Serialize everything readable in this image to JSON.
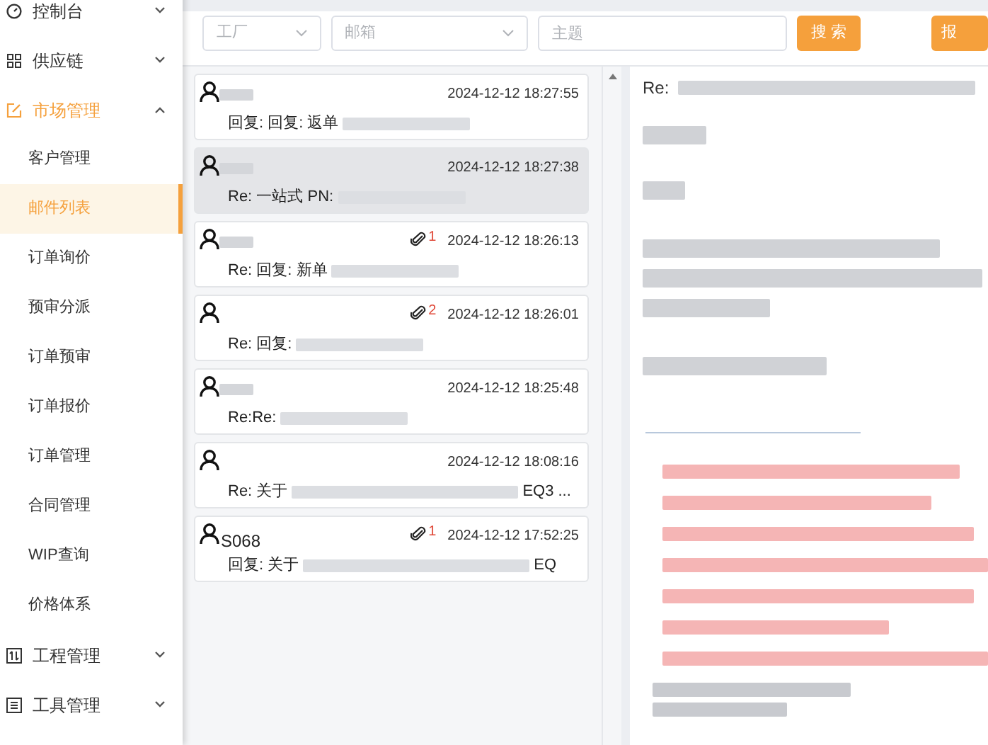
{
  "sidebar": {
    "items": [
      {
        "label": "控制台",
        "expanded": false
      },
      {
        "label": "供应链",
        "expanded": false
      },
      {
        "label": "市场管理",
        "expanded": true,
        "selected": true,
        "children": [
          {
            "label": "客户管理",
            "selected": false
          },
          {
            "label": "邮件列表",
            "selected": true
          },
          {
            "label": "订单询价",
            "selected": false
          },
          {
            "label": "预审分派",
            "selected": false
          },
          {
            "label": "订单预审",
            "selected": false
          },
          {
            "label": "订单报价",
            "selected": false
          },
          {
            "label": "订单管理",
            "selected": false
          },
          {
            "label": "合同管理",
            "selected": false
          },
          {
            "label": "WIP查询",
            "selected": false
          },
          {
            "label": "价格体系",
            "selected": false
          }
        ]
      },
      {
        "label": "工程管理",
        "expanded": false
      },
      {
        "label": "工具管理",
        "expanded": false
      }
    ]
  },
  "filters": {
    "factory": {
      "placeholder": "工厂"
    },
    "mailbox": {
      "placeholder": "邮箱"
    },
    "subject": {
      "placeholder": "主题"
    },
    "search_button": "搜 索",
    "quote_button": "报"
  },
  "emails": [
    {
      "sender_redacted": true,
      "time": "2024-12-12 18:27:55",
      "subject_start": "回复: 回复: 返单",
      "selected": false
    },
    {
      "sender_redacted": true,
      "time": "2024-12-12 18:27:38",
      "subject_start": "Re: 一站式 PN:",
      "selected": true
    },
    {
      "sender_redacted": true,
      "time": "2024-12-12 18:26:13",
      "attachments": "1",
      "subject_start": "Re: 回复: 新单",
      "selected": false
    },
    {
      "sender_redacted": false,
      "time": "2024-12-12 18:26:01",
      "attachments": "2",
      "subject_start": "Re: 回复:",
      "selected": false
    },
    {
      "sender_redacted": true,
      "time": "2024-12-12 18:25:48",
      "subject_start": "Re:Re:",
      "selected": false
    },
    {
      "sender_redacted": false,
      "time": "2024-12-12 18:08:16",
      "subject_start": "Re: 关于",
      "subject_end": "EQ3 ...",
      "selected": false
    },
    {
      "sender": "S068",
      "sender_redacted": false,
      "time": "2024-12-12 17:52:25",
      "attachments": "1",
      "subject_start": "回复: 关于",
      "subject_end": "EQ",
      "selected": false
    }
  ],
  "detail": {
    "subject_start": "Re:",
    "body": [
      {
        "kind": "plain"
      },
      {
        "kind": "plain"
      },
      {
        "kind": "plain"
      },
      {
        "kind": "plain"
      },
      {
        "kind": "plain"
      },
      {
        "kind": "plain"
      },
      {
        "kind": "rule"
      },
      {
        "kind": "highlight"
      },
      {
        "kind": "highlight"
      },
      {
        "kind": "highlight"
      },
      {
        "kind": "highlight"
      },
      {
        "kind": "highlight"
      },
      {
        "kind": "highlight"
      },
      {
        "kind": "highlight"
      },
      {
        "kind": "quote"
      },
      {
        "kind": "quote"
      }
    ]
  }
}
